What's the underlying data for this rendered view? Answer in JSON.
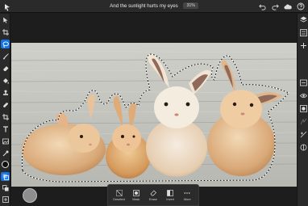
{
  "document": {
    "title": "And the sunlight hurts my eyes",
    "zoom": "31%"
  },
  "topbar": {
    "back_icon": "back-arrow-icon",
    "undo_icon": "undo-icon",
    "redo_icon": "redo-icon",
    "cloud_icon": "cloud-icon",
    "help_icon": "help-icon"
  },
  "left_tools": [
    "move-icon",
    "transform-icon",
    "lasso-select-icon",
    "brush-icon",
    "eraser-icon",
    "fill-icon",
    "clone-stamp-icon",
    "healing-brush-icon",
    "crop-icon",
    "type-icon",
    "place-image-icon",
    "eyedropper-icon",
    "color-swatch",
    "layer-mask-icon",
    "adjustments-icon",
    "more-tools-icon"
  ],
  "right_tools": [
    "layers-icon",
    "layer-properties-icon",
    "add-layer-icon",
    "layer-visibility-icon",
    "mask-icon",
    "clip-icon",
    "effects-icon"
  ],
  "taskbar": {
    "items": [
      {
        "label": "Deselect",
        "icon": "deselect-icon"
      },
      {
        "label": "Mask",
        "icon": "mask-icon"
      },
      {
        "label": "Erase",
        "icon": "erase-icon"
      },
      {
        "label": "Invert",
        "icon": "invert-icon"
      },
      {
        "label": "More",
        "icon": "more-icon"
      }
    ]
  },
  "colors": {
    "accent": "#1473e6",
    "chrome": "#2a2a2a",
    "background": "#1d1d1d"
  }
}
